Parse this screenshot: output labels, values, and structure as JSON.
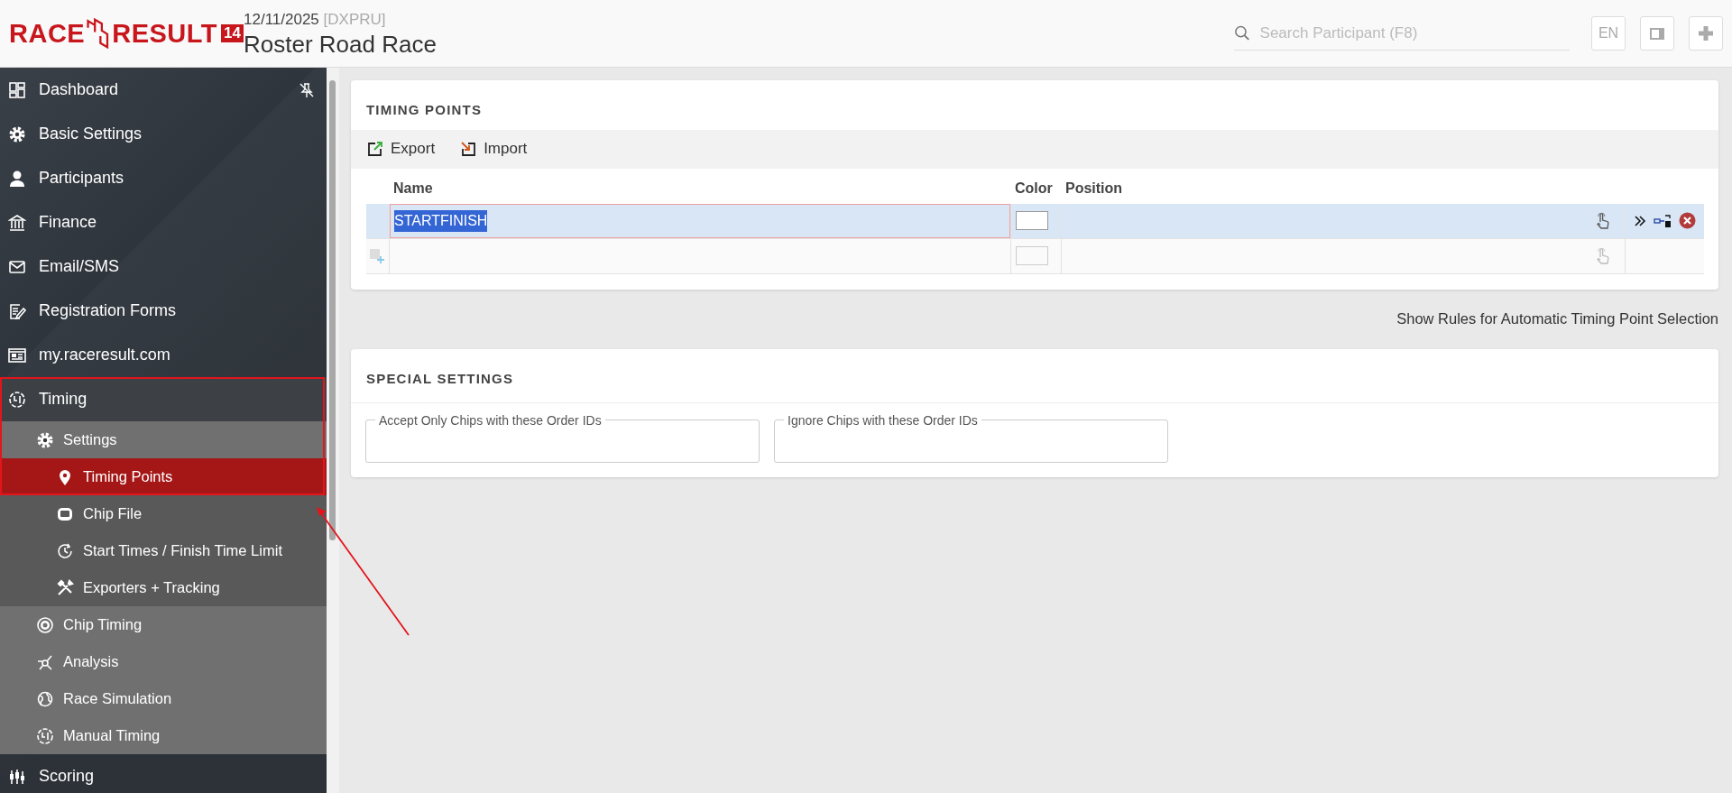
{
  "header": {
    "logo": {
      "word1": "RACE",
      "word2": "RESULT",
      "version": "14"
    },
    "date": "12/11/2025",
    "event_code": "[DXPRU]",
    "title": "Roster Road Race",
    "search": {
      "placeholder": "Search Participant (F8)"
    },
    "language": "EN"
  },
  "sidebar": {
    "items": [
      {
        "label": "Dashboard",
        "selected": false
      },
      {
        "label": "Basic Settings",
        "selected": false
      },
      {
        "label": "Participants",
        "selected": false
      },
      {
        "label": "Finance",
        "selected": false
      },
      {
        "label": "Email/SMS",
        "selected": false
      },
      {
        "label": "Registration Forms",
        "selected": false
      },
      {
        "label": "my.raceresult.com",
        "selected": false
      },
      {
        "label": "Timing",
        "selected": false,
        "expanded": true,
        "children": [
          {
            "label": "Settings",
            "selected": false,
            "expanded": true,
            "children": [
              {
                "label": "Timing Points",
                "selected": true
              },
              {
                "label": "Chip File",
                "selected": false
              },
              {
                "label": "Start Times / Finish Time Limit",
                "selected": false
              },
              {
                "label": "Exporters + Tracking",
                "selected": false
              }
            ]
          },
          {
            "label": "Chip Timing",
            "selected": false
          },
          {
            "label": "Analysis",
            "selected": false
          },
          {
            "label": "Race Simulation",
            "selected": false
          },
          {
            "label": "Manual Timing",
            "selected": false
          }
        ]
      },
      {
        "label": "Scoring",
        "selected": false
      }
    ]
  },
  "timing_points": {
    "title": "TIMING POINTS",
    "toolbar": [
      "Export",
      "Import"
    ],
    "columns": [
      "Name",
      "Color",
      "Position"
    ],
    "rows": [
      {
        "kind": "entry",
        "name": "STARTFINISH",
        "color": "#ffffff",
        "selected": true,
        "editing": true
      },
      {
        "kind": "new",
        "selected": false
      }
    ]
  },
  "rules_link": "Show Rules for Automatic Timing Point Selection",
  "special_settings": {
    "title": "SPECIAL SETTINGS",
    "fields": [
      {
        "label": "Accept Only Chips with these Order IDs"
      },
      {
        "label": "Ignore Chips with these Order IDs"
      }
    ]
  }
}
